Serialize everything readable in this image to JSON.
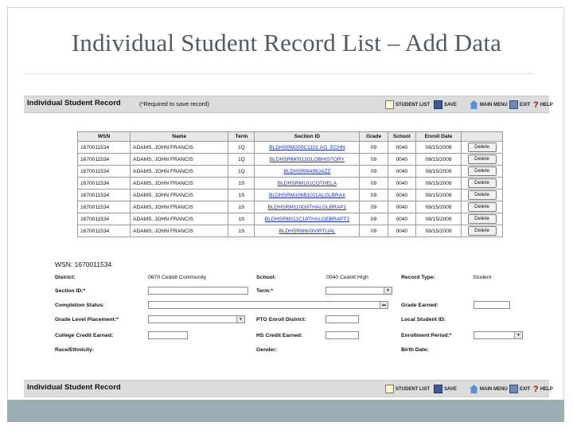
{
  "slide": {
    "title": "Individual Student Record List – Add Data"
  },
  "top_bar": {
    "title": "Individual Student Record",
    "note": "(*Required to save record)"
  },
  "toolbar": {
    "student_list": "STUDENT LIST",
    "save": "SAVE",
    "main_menu": "MAIN MENU",
    "exit": "EXIT",
    "help": "HELP",
    "help_mark": "?"
  },
  "table": {
    "headers": [
      "WSN",
      "Name",
      "Term",
      "Section ID",
      "Grade",
      "School",
      "Enroll Date",
      ""
    ],
    "delete_label": "Delete",
    "rows": [
      [
        "1670011534",
        "ADAMS, JOHN FRANCIS",
        "1Q",
        "BLDHSRM200C1101 AG_ECHN",
        "09",
        "0040",
        "08/15/2009"
      ],
      [
        "1670011534",
        "ADAMS, JOHN FRANCIS",
        "1Q",
        "BLDHSRM0012GLOBHISTORY",
        "09",
        "0040",
        "08/15/2009"
      ],
      [
        "1670011534",
        "ADAMS, JOHN FRANCIS",
        "1Q",
        "BLDHSRM499JAZZ",
        "09",
        "0040",
        "08/15/2009"
      ],
      [
        "1670011534",
        "ADAMS, JOHN FRANCIS",
        "1S",
        "BLDHSRM101COTHELA",
        "09",
        "0040",
        "08/15/2009"
      ],
      [
        "1670011534",
        "ADAMS, JOHN FRANCIS",
        "1S",
        "BLDHSRM106B1011ALGLBRAII",
        "09",
        "0040",
        "08/15/2009"
      ],
      [
        "1670011534",
        "ADAMS, JOHN FRANCIS",
        "1S",
        "BLDHSRM110G9THALGLBRAP1",
        "09",
        "0040",
        "08/15/2009"
      ],
      [
        "1670011534",
        "ADAMS, JOHN FRANCIS",
        "1S",
        "BLDHSRM111C19THALGEBRAPT2",
        "09",
        "0040",
        "08/15/2009"
      ],
      [
        "1670011534",
        "ADAMS, JOHN FRANCIS",
        "1S",
        "BLDHSRM603VIRTUAL",
        "09",
        "0040",
        "08/15/2009"
      ]
    ]
  },
  "form": {
    "wsn": "WSN: 1670011534",
    "district_label": "District:",
    "district_value": "0670 Cedott Community",
    "school_label": "School:",
    "school_value": "0040 Cedott High",
    "record_type_label": "Record Type:",
    "record_type_value": "Student",
    "section_id_label": "Section ID:*",
    "term_label": "Term:*",
    "completion_status_label": "Completion Status:",
    "grade_earned_label": "Grade Earned:",
    "grade_level_placement_label": "Grade Level Placement:*",
    "pto_enroll_district_label": "PTO Enroll District:",
    "local_student_id_label": "Local Student ID:",
    "college_credit_earned_label": "College Credit Earned:",
    "hs_credit_earned_label": "HS Credit Earned:",
    "enrollment_period_label": "Enrollment Period:*",
    "race_ethnicity_label": "Race/Ethnicity:",
    "gender_label": "Gender:",
    "birth_date_label": "Birth Date:"
  },
  "bottom_bar": {
    "title": "Individual Student Record"
  },
  "colors": {
    "bar": "#dcdcdc",
    "link": "#1a2fbd",
    "footer": "#9aaeb4",
    "title": "#555a5e"
  }
}
